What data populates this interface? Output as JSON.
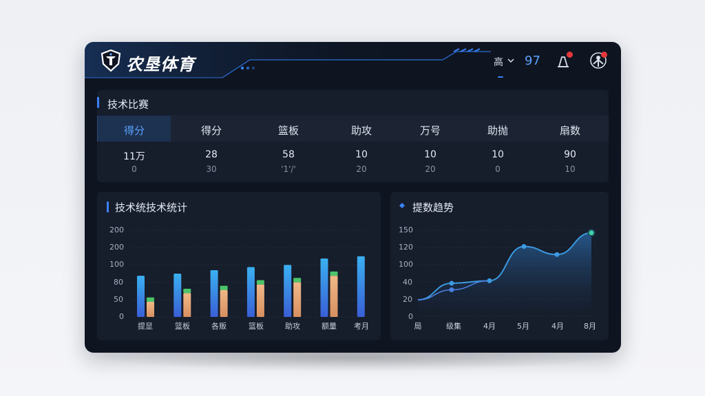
{
  "header": {
    "brand": "农垦体育",
    "lang_label": "高",
    "score": "97"
  },
  "tech": {
    "title": "技术比赛",
    "columns": [
      "得分",
      "得分",
      "篮板",
      "助攻",
      "万号",
      "助抛",
      "扇数"
    ],
    "row1": [
      "11万",
      "28",
      "58",
      "10",
      "10",
      "10",
      "90"
    ],
    "row2": [
      "0",
      "30",
      "'1'/'",
      "20",
      "20",
      "0",
      "10"
    ]
  },
  "bar_panel": {
    "title": "技术统技术统计",
    "y_ticks": [
      "200",
      "200",
      "100",
      "80",
      "50",
      "0"
    ],
    "x_labels": [
      "提显",
      "篮板",
      "各贩",
      "篮板",
      "助攻",
      "额量",
      "考月"
    ]
  },
  "line_panel": {
    "title": "提数趋势",
    "y_ticks": [
      "150",
      "120",
      "100",
      "40",
      "20",
      "0"
    ],
    "x_labels": [
      "局",
      "级集",
      "4月",
      "5月",
      "4月",
      "8月"
    ]
  },
  "chart_data": [
    {
      "type": "bar",
      "categories": [
        "提显",
        "篮板",
        "各贩",
        "篮板",
        "助攻",
        "额量",
        "考月"
      ],
      "series": [
        {
          "values": [
            95,
            100,
            108,
            115,
            120,
            135,
            140
          ]
        },
        {
          "values": [
            35,
            55,
            62,
            75,
            80,
            95,
            null
          ]
        },
        {
          "values": [
            10,
            10,
            10,
            10,
            10,
            10,
            null
          ]
        }
      ],
      "ylim": [
        0,
        200
      ]
    },
    {
      "type": "line",
      "x": [
        "局",
        "级集",
        "4月",
        "5月",
        "4月",
        "8月"
      ],
      "series": [
        {
          "values": [
            12,
            45,
            50,
            118,
            102,
            145
          ]
        },
        {
          "values": [
            12,
            32,
            50,
            null,
            null,
            null
          ]
        }
      ],
      "ylim": [
        0,
        150
      ]
    }
  ],
  "colors": {
    "accent": "#3b82f6",
    "bar_blue": "#3a8ee6",
    "bar_orange": "#e5a77a",
    "bar_green": "#4cc46a",
    "line": "#3b9ae0"
  }
}
